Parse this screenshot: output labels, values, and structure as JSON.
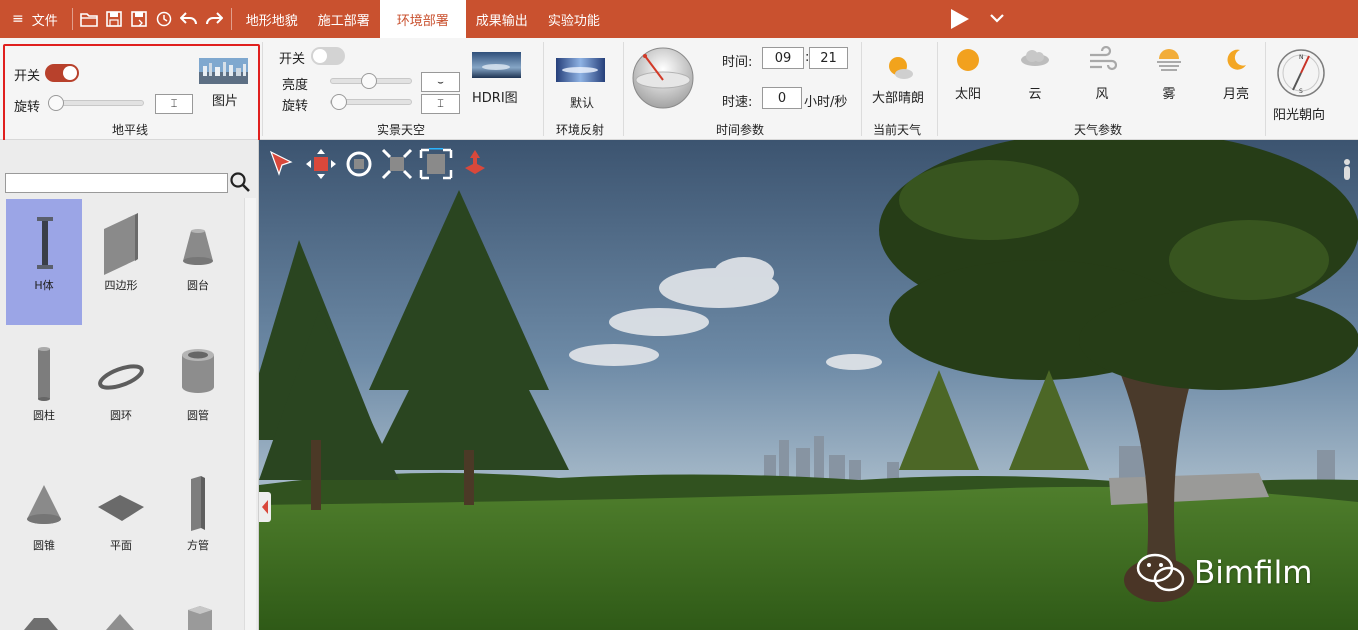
{
  "menubar": {
    "file_label": "文件",
    "tabs": [
      {
        "label": "地形地貌",
        "active": false
      },
      {
        "label": "施工部署",
        "active": false
      },
      {
        "label": "环境部署",
        "active": true
      },
      {
        "label": "成果输出",
        "active": false
      },
      {
        "label": "实验功能",
        "active": false
      }
    ]
  },
  "horizon": {
    "switch_label": "开关",
    "switch_on": true,
    "rotate_label": "旋转",
    "rotate_value": "",
    "image_label": "图片",
    "group_label": "地平线"
  },
  "realsky": {
    "switch_label": "开关",
    "switch_on": false,
    "brightness_label": "亮度",
    "brightness_value": "",
    "rotate_label": "旋转",
    "rotate_value": "",
    "hdri_label": "HDRI图",
    "group_label": "实景天空"
  },
  "envreflect": {
    "default_label": "默认",
    "group_label": "环境反射"
  },
  "timeparams": {
    "time_label": "时间:",
    "hour": "09",
    "colon": ":",
    "minute": "21",
    "speed_label": "时速:",
    "speed_value": "0",
    "speed_unit": "小时/秒",
    "group_label": "时间参数"
  },
  "current_weather": {
    "label": "大部晴朗",
    "group_label": "当前天气"
  },
  "weather": {
    "items": [
      {
        "label": "太阳",
        "icon": "sun-icon"
      },
      {
        "label": "云",
        "icon": "cloud-icon"
      },
      {
        "label": "风",
        "icon": "wind-icon"
      },
      {
        "label": "雾",
        "icon": "fog-icon"
      },
      {
        "label": "月亮",
        "icon": "moon-icon"
      }
    ],
    "group_label": "天气参数"
  },
  "sun_direction": {
    "label": "阳光朝向"
  },
  "library": {
    "search_placeholder": "",
    "items": [
      {
        "label": "H体",
        "selected": true
      },
      {
        "label": "四边形",
        "selected": false
      },
      {
        "label": "圆台",
        "selected": false
      },
      {
        "label": "圆柱",
        "selected": false
      },
      {
        "label": "圆环",
        "selected": false
      },
      {
        "label": "圆管",
        "selected": false
      },
      {
        "label": "圆锥",
        "selected": false
      },
      {
        "label": "平面",
        "selected": false
      },
      {
        "label": "方管",
        "selected": false
      }
    ]
  },
  "viewport": {
    "watermark": "Bimfilm"
  },
  "colors": {
    "accent": "#c9512f",
    "highlight": "#e0201e",
    "selected": "#9ba5e6"
  }
}
